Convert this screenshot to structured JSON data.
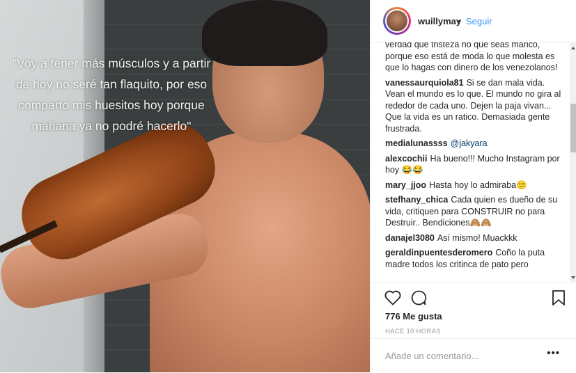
{
  "post": {
    "image_overlay_quote": [
      "\"Voy a tener más músculos y a partir",
      "de hoy no seré tan flaquito, por eso",
      "comparto mis huesitos hoy porque",
      "mañana ya no podré hacerlo\""
    ]
  },
  "header": {
    "username": "wuillymay",
    "separator": "•",
    "follow_label": "Seguir"
  },
  "comments": [
    {
      "user": "",
      "text": "verdad que tristeza no que seas marico, porque eso está de moda lo que molesta es que lo hagas con dinero de los venezolanos!"
    },
    {
      "user": "vanessaurquiola81",
      "text": "Si se dan mala vida. Vean el mundo es lo que. El mundo no gira al rededor de cada uno. Dejen la paja vivan... Que la vida es un ratico. Demasiada gente frustrada."
    },
    {
      "user": "medialunassss",
      "mention": "@jakyara",
      "text": ""
    },
    {
      "user": "alexcochii",
      "text": "Ha bueno!!! Mucho Instagram por hoy 😂😂"
    },
    {
      "user": "mary_jjoo",
      "text": "Hasta hoy lo admiraba😕"
    },
    {
      "user": "stefhany_chica",
      "text": "Cada quien es dueño de su vida, critiquen para CONSTRUIR no para Destruir.. Bendiciones🙈🙈"
    },
    {
      "user": "danajel3080",
      "text": "Así mismo! Muackkk"
    },
    {
      "user": "geraldinpuentesderomero",
      "text": "Coño la puta madre todos los critinca de pato pero"
    }
  ],
  "actions": {
    "like_icon": "heart-icon",
    "comment_icon": "comment-bubble-icon",
    "save_icon": "bookmark-icon",
    "likes_text": "776 Me gusta",
    "time_text": "HACE 10 HORAS"
  },
  "add_comment": {
    "placeholder": "Añade un comentario...",
    "more_label": "•••"
  },
  "colors": {
    "link_blue": "#3897f0",
    "mention_blue": "#003569",
    "text": "#262626",
    "muted": "#999999"
  }
}
